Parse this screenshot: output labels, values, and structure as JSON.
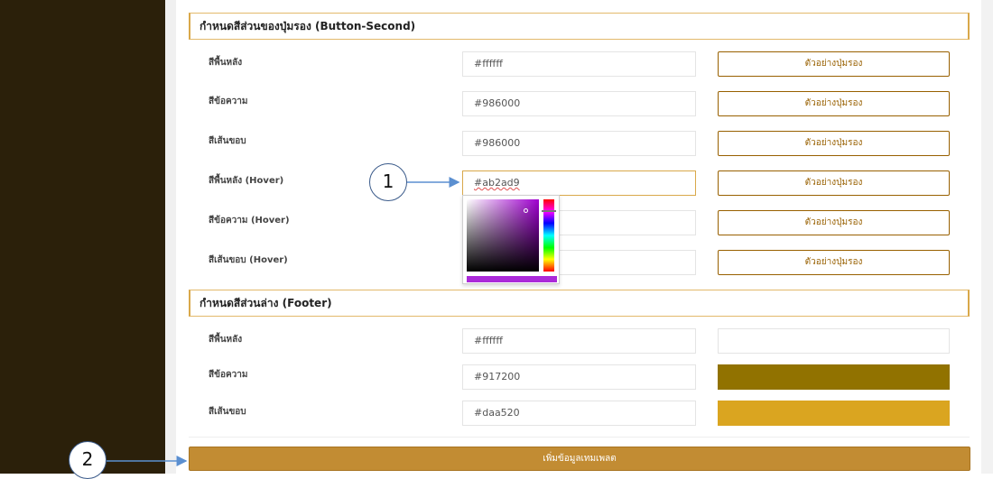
{
  "sections": {
    "button_second": {
      "title": "กำหนดสีส่วนของปุ่มรอง (Button-Second)",
      "rows": [
        {
          "label": "สีพื้นหลัง",
          "value": "#ffffff",
          "preview": "ตัวอย่างปุ่มรอง"
        },
        {
          "label": "สีข้อความ",
          "value": "#986000",
          "preview": "ตัวอย่างปุ่มรอง"
        },
        {
          "label": "สีเส้นขอบ",
          "value": "#986000",
          "preview": "ตัวอย่างปุ่มรอง"
        },
        {
          "label": "สีพื้นหลัง (Hover)",
          "value": "#ab2ad9",
          "preview": "ตัวอย่างปุ่มรอง"
        },
        {
          "label": "สีข้อความ (Hover)",
          "value": "",
          "preview": "ตัวอย่างปุ่มรอง"
        },
        {
          "label": "สีเส้นขอบ (Hover)",
          "value": "",
          "preview": "ตัวอย่างปุ่มรอง"
        }
      ]
    },
    "footer": {
      "title": "กำหนดสีส่วนล่าง (Footer)",
      "rows": [
        {
          "label": "สีพื้นหลัง",
          "value": "#ffffff",
          "swatch": "#ffffff"
        },
        {
          "label": "สีข้อความ",
          "value": "#917200",
          "swatch": "#917200"
        },
        {
          "label": "สีเส้นขอบ",
          "value": "#daa520",
          "swatch": "#daa520"
        }
      ]
    }
  },
  "color_picker": {
    "selected_color": "#ab2ad9"
  },
  "submit": {
    "label": "เพิ่มข้อมูลเทมเพลต"
  },
  "callouts": {
    "one": "1",
    "two": "2"
  },
  "colors": {
    "sidebar": "#2b200a",
    "accent": "#c28c33",
    "button_text": "#986000",
    "callout_border": "#3a5a8a"
  }
}
